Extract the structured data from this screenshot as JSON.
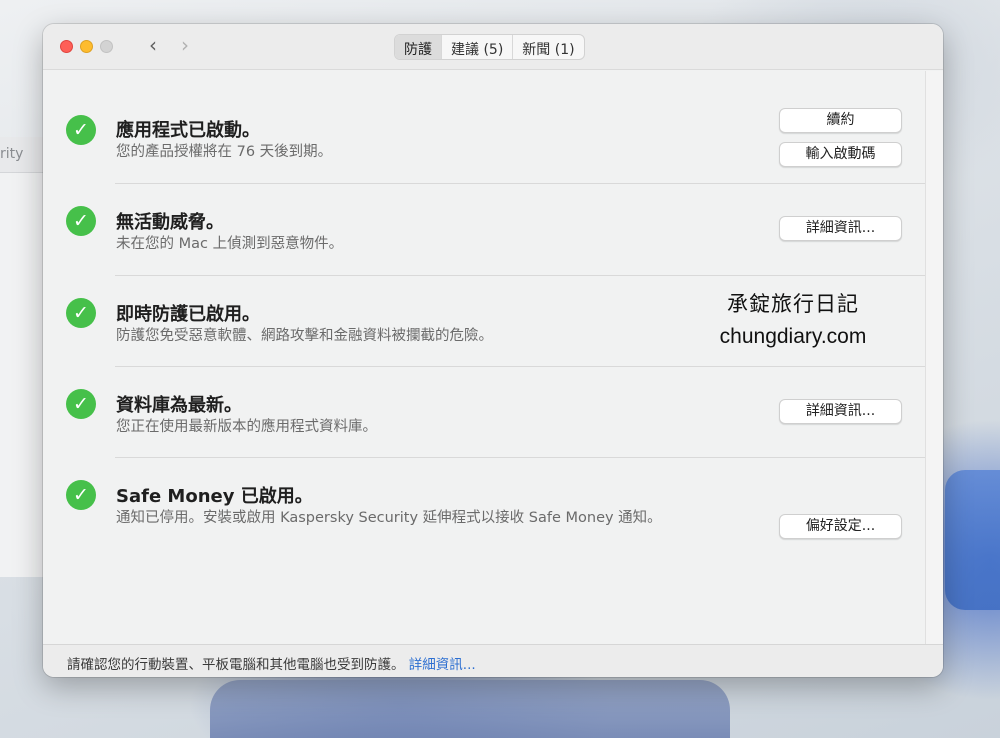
{
  "background": {
    "behind_window_title": "rity"
  },
  "window": {
    "tabs": [
      {
        "label": "防護",
        "active": true
      },
      {
        "label": "建議 (5)",
        "active": false
      },
      {
        "label": "新聞 (1)",
        "active": false
      }
    ]
  },
  "status_items": [
    {
      "title": "應用程式已啟動。",
      "description": "您的產品授權將在 76 天後到期。",
      "buttons": [
        "續約",
        "輸入啟動碼"
      ]
    },
    {
      "title": "無活動威脅。",
      "description": "未在您的 Mac 上偵測到惡意物件。",
      "buttons": [
        "詳細資訊..."
      ]
    },
    {
      "title": "即時防護已啟用。",
      "description": "防護您免受惡意軟體、網路攻擊和金融資料被攔截的危險。",
      "buttons": []
    },
    {
      "title": "資料庫為最新。",
      "description": "您正在使用最新版本的應用程式資料庫。",
      "buttons": [
        "詳細資訊..."
      ]
    },
    {
      "title": "Safe Money 已啟用。",
      "description": "通知已停用。安裝或啟用 Kaspersky Security 延伸程式以接收 Safe Money 通知。",
      "buttons": [
        "偏好設定..."
      ]
    }
  ],
  "watermark": {
    "line1": "承錠旅行日記",
    "line2": "chungdiary.com"
  },
  "footer": {
    "text": "請確認您的行動裝置、平板電腦和其他電腦也受到防護。",
    "link": "詳細資訊..."
  },
  "icons": {
    "check": "✓",
    "back": "‹",
    "forward": "›"
  },
  "colors": {
    "check_green": "#46c04a",
    "link_blue": "#2d6fd1"
  }
}
